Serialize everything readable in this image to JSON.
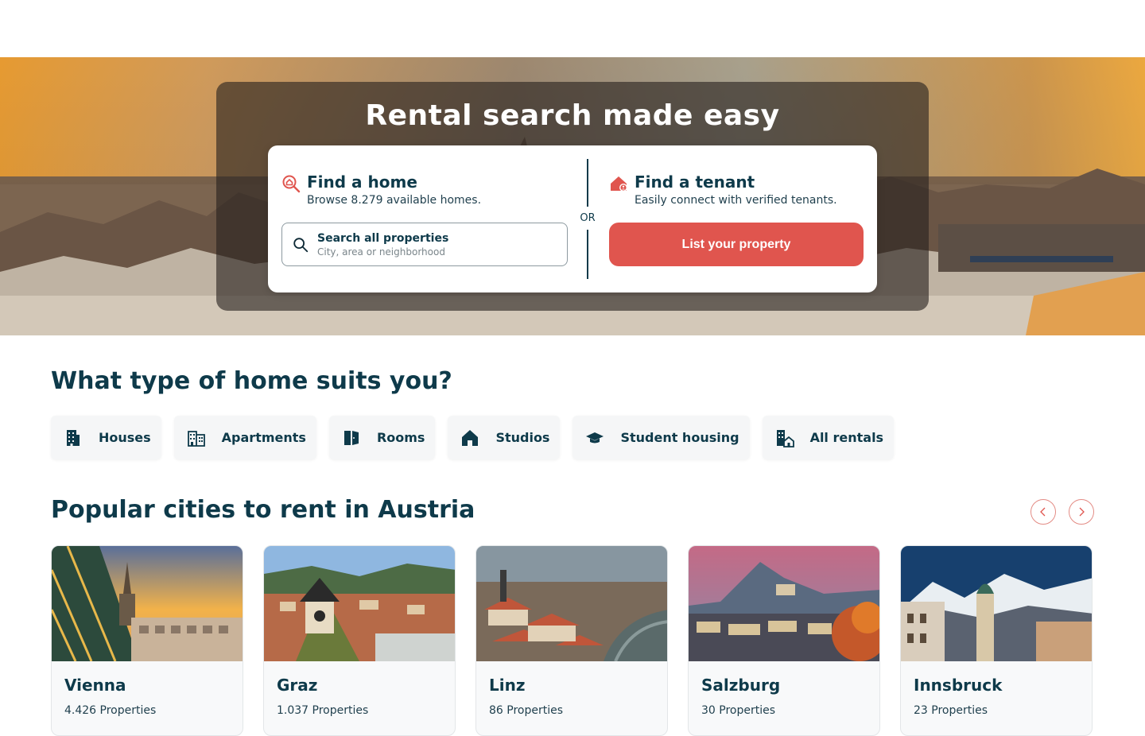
{
  "hero": {
    "title": "Rental search made easy",
    "find_home": {
      "title": "Find a home",
      "subtitle": "Browse 8.279 available homes.",
      "search_label": "Search all properties",
      "search_placeholder": "City, area or neighborhood"
    },
    "or_label": "OR",
    "find_tenant": {
      "title": "Find a tenant",
      "subtitle": "Easily connect with verified tenants.",
      "button_label": "List your property"
    }
  },
  "home_types": {
    "title": "What type of home suits you?",
    "items": [
      {
        "label": "Houses",
        "icon": "building-icon"
      },
      {
        "label": "Apartments",
        "icon": "apartment-building-icon"
      },
      {
        "label": "Rooms",
        "icon": "door-icon"
      },
      {
        "label": "Studios",
        "icon": "house-icon"
      },
      {
        "label": "Student housing",
        "icon": "graduation-cap-icon"
      },
      {
        "label": "All rentals",
        "icon": "city-home-icon"
      }
    ]
  },
  "cities": {
    "title": "Popular cities to rent in Austria",
    "items": [
      {
        "name": "Vienna",
        "count": "4.426 Properties"
      },
      {
        "name": "Graz",
        "count": "1.037 Properties"
      },
      {
        "name": "Linz",
        "count": "86 Properties"
      },
      {
        "name": "Salzburg",
        "count": "30 Properties"
      },
      {
        "name": "Innsbruck",
        "count": "23 Properties"
      }
    ]
  },
  "colors": {
    "accent": "#e0554e",
    "primary_text": "#0e3a4a"
  }
}
